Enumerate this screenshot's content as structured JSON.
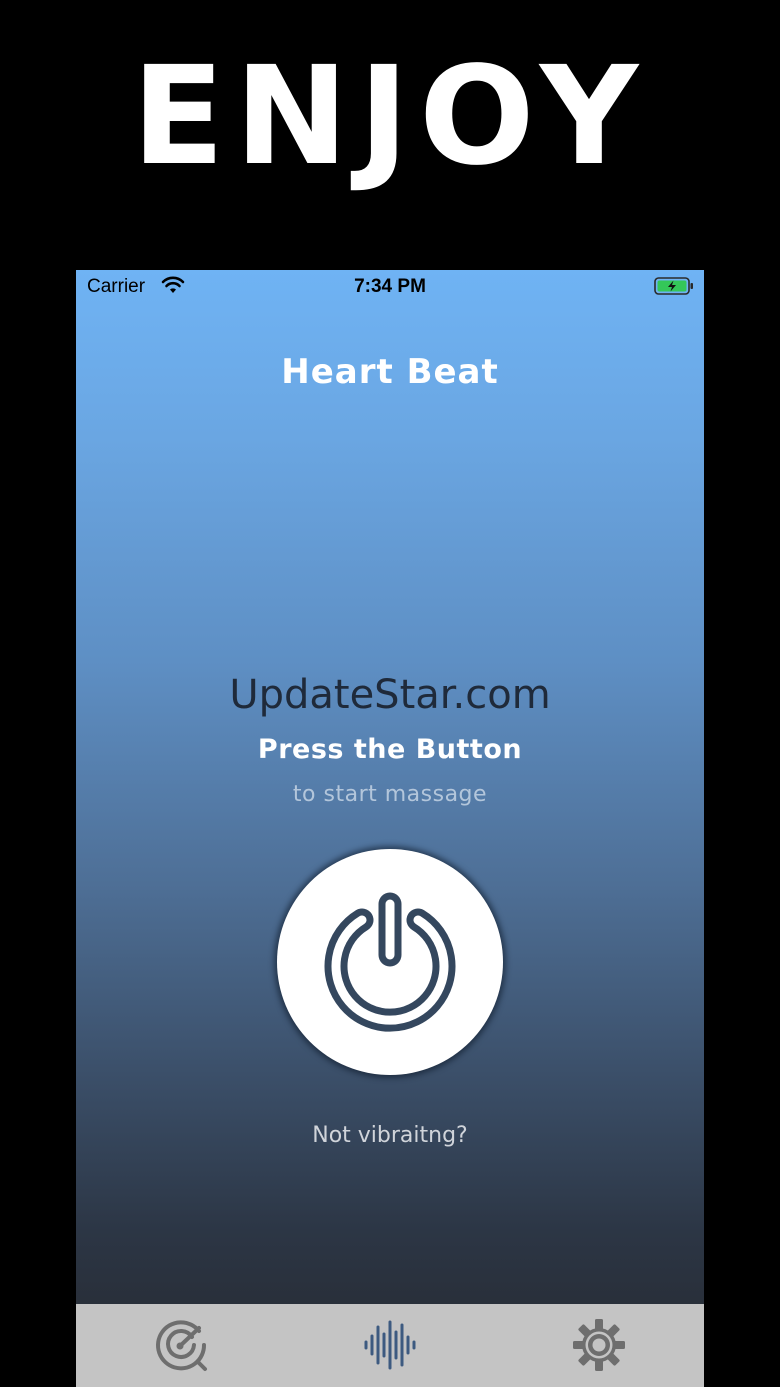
{
  "headline": "ENJOY",
  "status_bar": {
    "carrier": "Carrier",
    "time": "7:34 PM"
  },
  "app": {
    "title": "Heart Beat",
    "watermark": "UpdateStar.com",
    "prompt_title": "Press the Button",
    "prompt_subtitle": "to start massage",
    "help_link": "Not vibraitng?"
  },
  "tab_bar": {
    "items": [
      {
        "icon": "radar-icon",
        "active": false
      },
      {
        "icon": "waveform-icon",
        "active": true
      },
      {
        "icon": "gear-icon",
        "active": false
      }
    ]
  },
  "colors": {
    "gradient_top": "#6fb3f4",
    "gradient_bottom": "#25282e",
    "tab_bar_bg": "#c4c4c4",
    "tab_inactive": "#6e6e6e",
    "tab_active": "#3d5a80",
    "power_icon": "#34475e",
    "battery_green": "#34c759"
  }
}
